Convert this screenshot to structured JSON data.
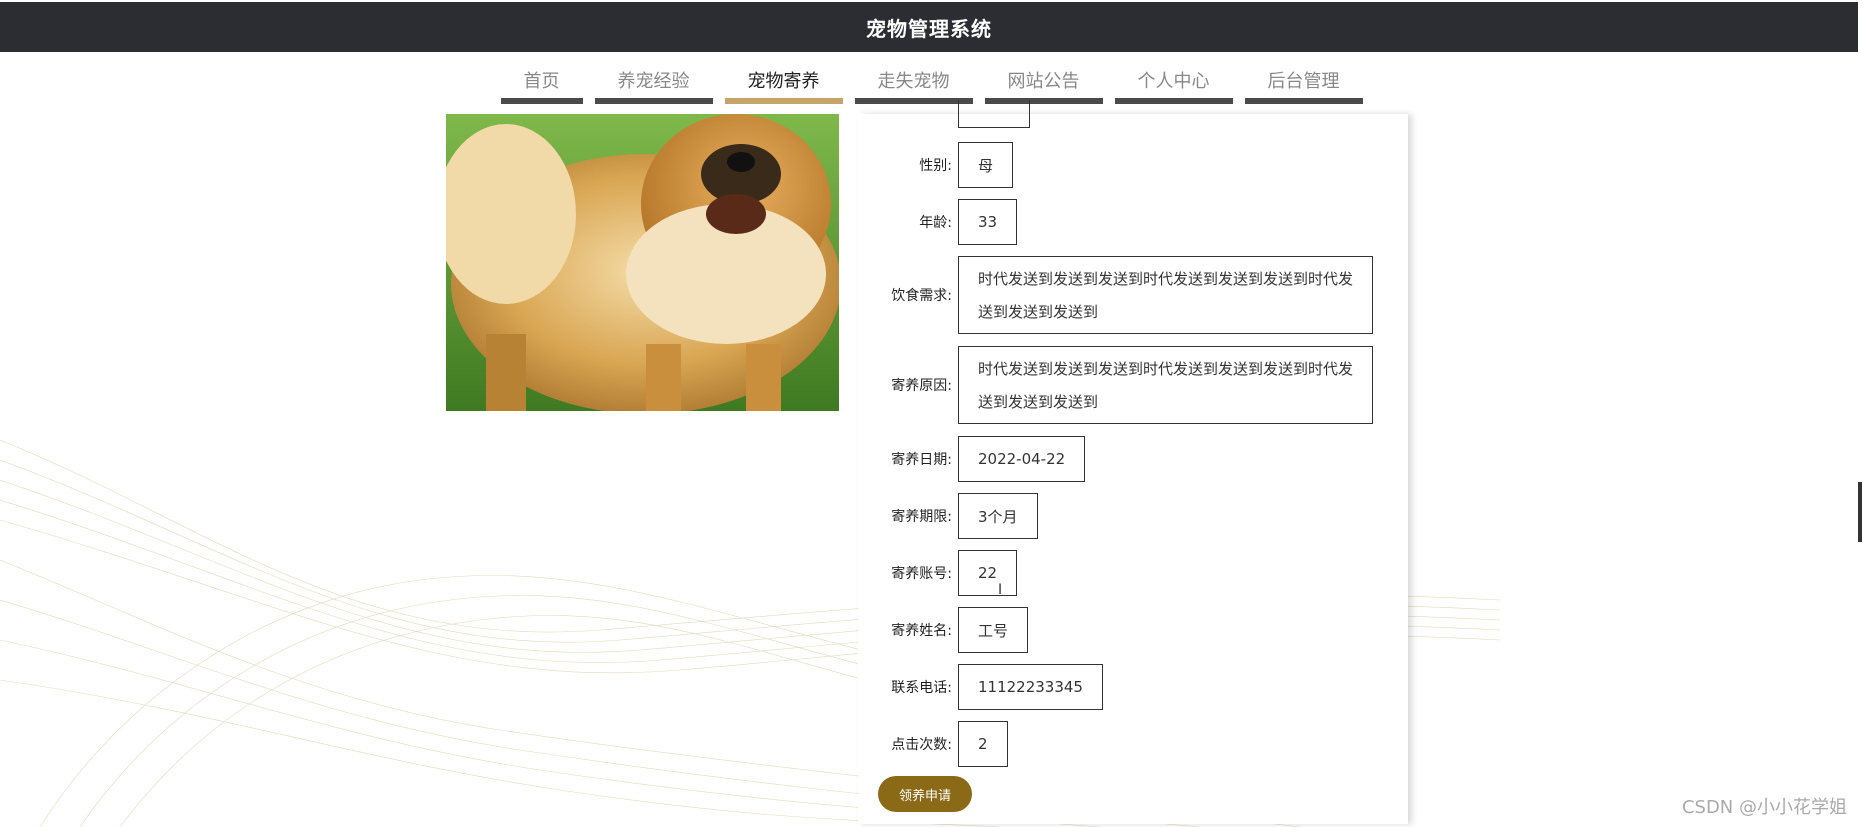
{
  "header": {
    "title": "宠物管理系统"
  },
  "nav": {
    "items": [
      {
        "label": "首页",
        "active": false
      },
      {
        "label": "养宠经验",
        "active": false
      },
      {
        "label": "宠物寄养",
        "active": true
      },
      {
        "label": "走失宠物",
        "active": false
      },
      {
        "label": "网站公告",
        "active": false
      },
      {
        "label": "个人中心",
        "active": false
      },
      {
        "label": "后台管理",
        "active": false
      }
    ]
  },
  "pet": {
    "image_alt": "chow-chow dog on grass",
    "fields": {
      "gender": {
        "label": "性别:",
        "value": "母"
      },
      "age": {
        "label": "年龄:",
        "value": "33"
      },
      "diet": {
        "label": "饮食需求:",
        "value": "时代发送到发送到发送到时代发送到发送到发送到时代发送到发送到发送到"
      },
      "reason": {
        "label": "寄养原因:",
        "value": "时代发送到发送到发送到时代发送到发送到发送到时代发送到发送到发送到"
      },
      "date": {
        "label": "寄养日期:",
        "value": "2022-04-22"
      },
      "period": {
        "label": "寄养期限:",
        "value": "3个月"
      },
      "account": {
        "label": "寄养账号:",
        "value": "22"
      },
      "name": {
        "label": "寄养姓名:",
        "value": "工号"
      },
      "phone": {
        "label": "联系电话:",
        "value": "11122233345"
      },
      "clicks": {
        "label": "点击次数:",
        "value": "2"
      }
    }
  },
  "actions": {
    "adopt_label": "领养申请"
  },
  "watermark": "CSDN @小小花学姐",
  "colors": {
    "topbar": "#2b2d33",
    "accent": "#c4a46a",
    "button": "#8b6a17"
  }
}
